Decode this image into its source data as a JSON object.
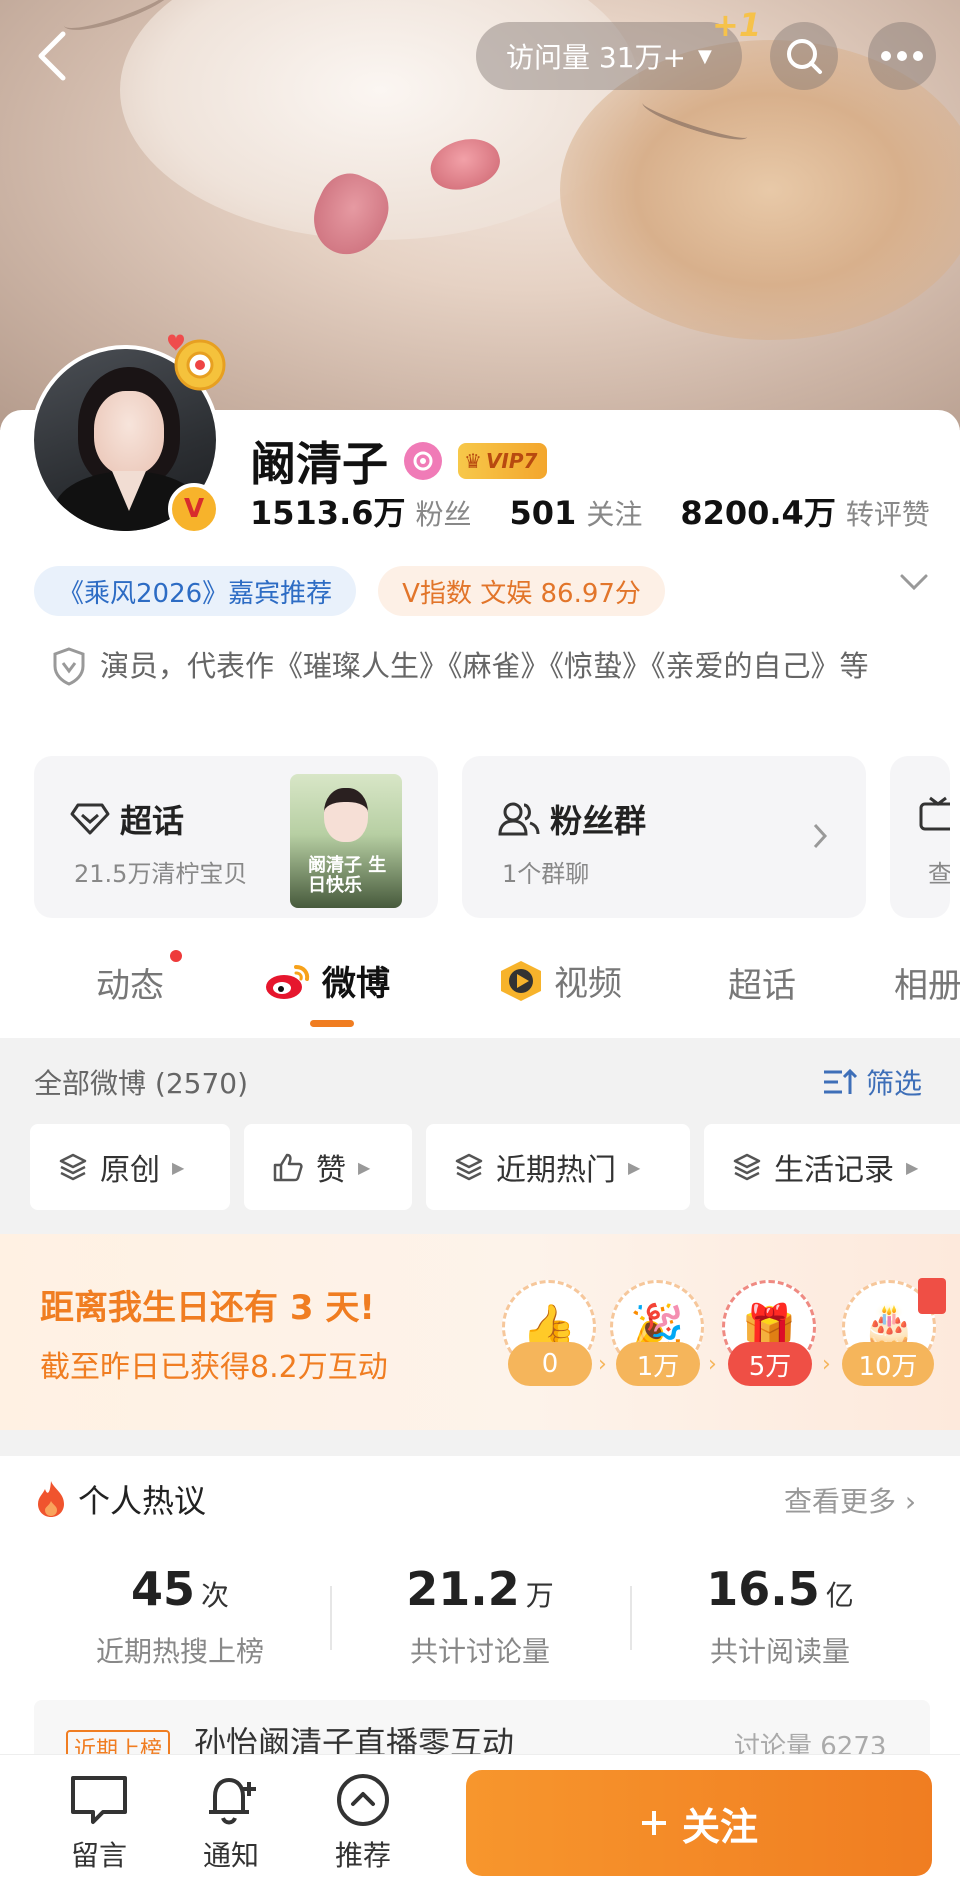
{
  "header": {
    "visit_label": "访问量 31万+",
    "plus_one": "+1"
  },
  "profile": {
    "name": "阚清子",
    "vip_label": "VIP7",
    "stats": [
      {
        "num": "1513.6万",
        "label": "粉丝"
      },
      {
        "num": "501",
        "label": "关注"
      },
      {
        "num": "8200.4万",
        "label": "转评赞"
      }
    ],
    "tag_guest": "《乘风2026》嘉宾推荐",
    "tag_index": "V指数 文娱 86.97分",
    "bio": "演员，代表作《璀璨人生》《麻雀》《惊蛰》《亲爱的自己》等"
  },
  "features": {
    "super_topic_title": "超话",
    "super_topic_sub": "21.5万清柠宝贝",
    "poster_text": "阚清子 生日快乐",
    "fan_group_title": "粉丝群",
    "fan_group_sub": "1个群聊",
    "third_sub": "查"
  },
  "tabs": {
    "items": [
      "动态",
      "微博",
      "视频",
      "超话",
      "相册"
    ]
  },
  "filter": {
    "all_label": "全部微博 (2570)",
    "filter_label": "筛选",
    "chips": [
      "原创",
      "赞",
      "近期热门",
      "生活记录"
    ]
  },
  "banner": {
    "title": "距离我生日还有 3 天!",
    "subtitle": "截至昨日已获得8.2万互动",
    "milestones": [
      "0",
      "1万",
      "5万",
      "10万"
    ]
  },
  "discussion": {
    "title": "个人热议",
    "more": "查看更多",
    "stats": [
      {
        "num": "45",
        "unit": "次",
        "label": "近期热搜上榜"
      },
      {
        "num": "21.2",
        "unit": "万",
        "label": "共计讨论量"
      },
      {
        "num": "16.5",
        "unit": "亿",
        "label": "共计阅读量"
      }
    ],
    "hot_badge": "近期上榜",
    "hot_text": "孙怡阚清子直播零互动",
    "hot_count": "讨论量 6273"
  },
  "bottom": {
    "items": [
      "留言",
      "通知",
      "推荐"
    ],
    "follow_label": "关注"
  },
  "colors": {
    "accent": "#f07d21",
    "link_blue": "#3e6fb8",
    "verified": "#f7b32b"
  }
}
